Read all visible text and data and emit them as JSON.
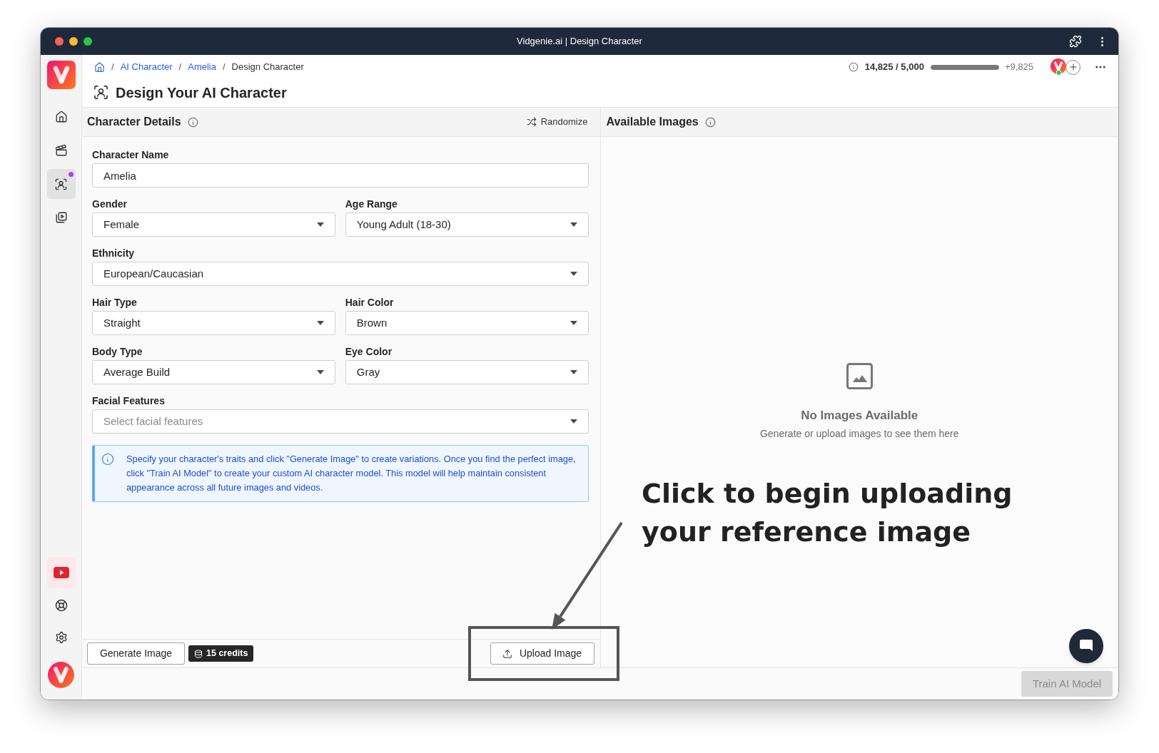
{
  "window": {
    "title": "Vidgenie.ai | Design Character"
  },
  "sidebar": {
    "nav": [
      {
        "selected": false,
        "notification": false
      },
      {
        "selected": false,
        "notification": false
      },
      {
        "selected": true,
        "notification": true
      },
      {
        "selected": false,
        "notification": false
      }
    ]
  },
  "breadcrumb": [
    {
      "separator": "/",
      "label": "AI Character",
      "link": true
    },
    {
      "separator": "/",
      "label": "Amelia",
      "link": true
    },
    {
      "separator": "/",
      "label": "Design Character",
      "link": false
    }
  ],
  "credits": {
    "usage": "14,825 / 5,000",
    "level": 1,
    "bonus": "+9,825"
  },
  "page_title": "Design Your AI Character",
  "character_details": {
    "title": "Character Details",
    "randomize": "Randomize",
    "rows": [
      [
        {
          "kind": "text",
          "label": "Character Name",
          "value": "Amelia"
        }
      ],
      [
        {
          "kind": "select",
          "label": "Gender",
          "value": "Female"
        },
        {
          "kind": "select",
          "label": "Age Range",
          "value": "Young Adult (18-30)"
        }
      ],
      [
        {
          "kind": "select",
          "label": "Ethnicity",
          "value": "European/Caucasian"
        }
      ],
      [
        {
          "kind": "select",
          "label": "Hair Type",
          "value": "Straight"
        },
        {
          "kind": "select",
          "label": "Hair Color",
          "value": "Brown"
        }
      ],
      [
        {
          "kind": "select",
          "label": "Body Type",
          "value": "Average Build"
        },
        {
          "kind": "select",
          "label": "Eye Color",
          "value": "Gray"
        }
      ],
      [
        {
          "kind": "select",
          "label": "Facial Features",
          "placeholder": "Select facial features"
        }
      ]
    ],
    "note": "Specify your character's traits and click \"Generate Image\" to create variations. Once you find the perfect image, click \"Train AI Model\" to create your custom AI character model. This model will help maintain consistent appearance across all future images and videos.",
    "generate_button": "Generate Image",
    "cost": "15 credits",
    "upload_button": "Upload Image"
  },
  "available_images": {
    "title": "Available Images",
    "empty_title": "No Images Available",
    "empty_text": "Generate or upload images to see them here"
  },
  "train_button": {
    "label": "Train AI Model",
    "disabled": true
  },
  "annotation": {
    "text": "Click to begin uploading your reference image"
  }
}
